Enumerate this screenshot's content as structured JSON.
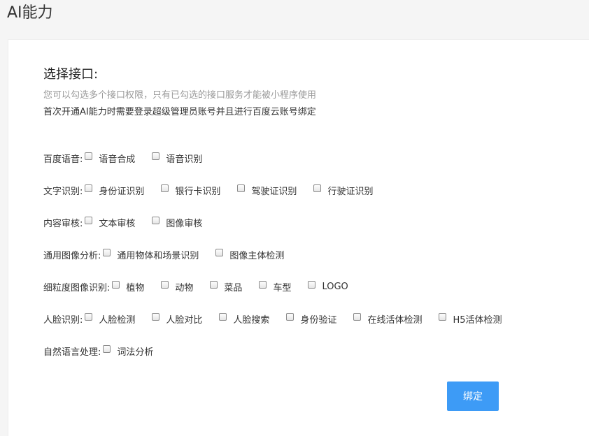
{
  "page": {
    "title": "AI能力"
  },
  "content": {
    "section_title": "选择接口:",
    "hint": "您可以勾选多个接口权限，只有已勾选的接口服务才能被小程序使用",
    "note": "首次开通AI能力时需要登录超级管理员账号并且进行百度云账号绑定"
  },
  "groups": [
    {
      "label": "百度语音:",
      "options": [
        "语音合成",
        "语音识别"
      ]
    },
    {
      "label": "文字识别:",
      "options": [
        "身份证识别",
        "银行卡识别",
        "驾驶证识别",
        "行驶证识别"
      ]
    },
    {
      "label": "内容审核:",
      "options": [
        "文本审核",
        "图像审核"
      ]
    },
    {
      "label": "通用图像分析:",
      "options": [
        "通用物体和场景识别",
        "图像主体检测"
      ]
    },
    {
      "label": "细粒度图像识别:",
      "options": [
        "植物",
        "动物",
        "菜品",
        "车型",
        "LOGO"
      ]
    },
    {
      "label": "人脸识别:",
      "options": [
        "人脸检测",
        "人脸对比",
        "人脸搜索",
        "身份验证",
        "在线活体检测",
        "H5活体检测"
      ]
    },
    {
      "label": "自然语言处理:",
      "options": [
        "词法分析"
      ]
    }
  ],
  "actions": {
    "bind_label": "绑定"
  }
}
